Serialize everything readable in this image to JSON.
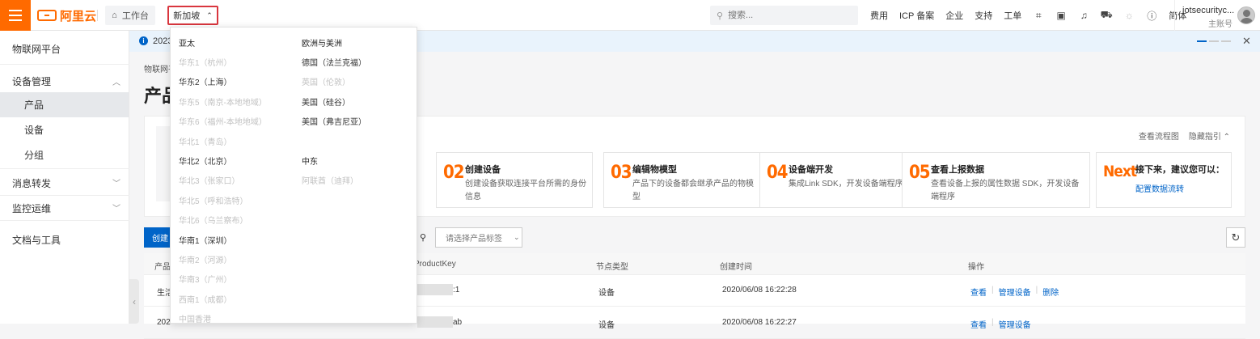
{
  "topbar": {
    "logo_text": "阿里云",
    "workbench_label": "工作台",
    "region_label": "新加坡",
    "search_placeholder": "搜索...",
    "nav": [
      "费用",
      "ICP 备案",
      "企业",
      "支持",
      "工单"
    ],
    "lang": "简体",
    "account_name": "iotsecurityc...",
    "account_type": "主账号"
  },
  "sidebar": {
    "title": "物联网平台",
    "groups": {
      "device_mgmt": "设备管理",
      "msg_forward": "消息转发",
      "monitor_ops": "监控运维",
      "docs_tools": "文档与工具"
    },
    "items": [
      "产品",
      "设备",
      "分组"
    ]
  },
  "notice": {
    "text": "2023"
  },
  "breadcrumb": "物联网平",
  "page_title": "产品",
  "guide": {
    "view_flow": "查看流程图",
    "hide_guide": "隐藏指引",
    "steps": [
      {
        "num": "02",
        "title": "创建设备",
        "desc": "创建设备获取连接平台所需的身份信息"
      },
      {
        "num": "03",
        "title": "编辑物模型",
        "desc": "产品下的设备都会继承产品的物模型"
      },
      {
        "num": "04",
        "title": "设备端开发",
        "desc": "集成Link SDK，开发设备端程序"
      },
      {
        "num": "05",
        "title": "查看上报数据",
        "desc": "查看设备上报的属性数据 SDK，开发设备端程序"
      },
      {
        "num": "Next",
        "title": "接下来，建议您可以：",
        "link": "配置数据流转"
      }
    ]
  },
  "toolbar": {
    "create_label": "创建",
    "tag_placeholder": "请选择产品标签"
  },
  "table": {
    "headers": [
      "产品",
      "ProductKey",
      "节点类型",
      "创建时间",
      "操作"
    ],
    "rows": [
      {
        "name": "生活",
        "key_tail": ":1",
        "node": "设备",
        "time": "2020/06/08 16:22:28",
        "ops": [
          "查看",
          "管理设备",
          "删除"
        ]
      },
      {
        "name": "202",
        "key_tail": "ab",
        "node": "设备",
        "time": "2020/06/08 16:22:27",
        "ops": [
          "查看",
          "管理设备"
        ]
      }
    ]
  },
  "region_dropdown": {
    "col1_head": "亚太",
    "col1": [
      {
        "label": "华东1（杭州）",
        "disabled": true
      },
      {
        "label": "华东2（上海）",
        "disabled": false
      },
      {
        "label": "华东5（南京-本地地域）",
        "disabled": true
      },
      {
        "label": "华东6（福州-本地地域）",
        "disabled": true
      },
      {
        "label": "华北1（青岛）",
        "disabled": true
      },
      {
        "label": "华北2（北京）",
        "disabled": false
      },
      {
        "label": "华北3（张家口）",
        "disabled": true
      },
      {
        "label": "华北5（呼和浩特）",
        "disabled": true
      },
      {
        "label": "华北6（乌兰察布）",
        "disabled": true
      },
      {
        "label": "华南1（深圳）",
        "disabled": false
      },
      {
        "label": "华南2（河源）",
        "disabled": true
      },
      {
        "label": "华南3（广州）",
        "disabled": true
      },
      {
        "label": "西南1（成都）",
        "disabled": true
      },
      {
        "label": "中国香港",
        "disabled": true
      }
    ],
    "col2_head": "欧洲与美洲",
    "col2": [
      {
        "label": "德国（法兰克福）",
        "disabled": false
      },
      {
        "label": "英国（伦敦）",
        "disabled": true
      },
      {
        "label": "美国（硅谷）",
        "disabled": false
      },
      {
        "label": "美国（弗吉尼亚）",
        "disabled": false
      }
    ],
    "col3_head": "中东",
    "col3": [
      {
        "label": "阿联酋（迪拜）",
        "disabled": true
      }
    ]
  }
}
